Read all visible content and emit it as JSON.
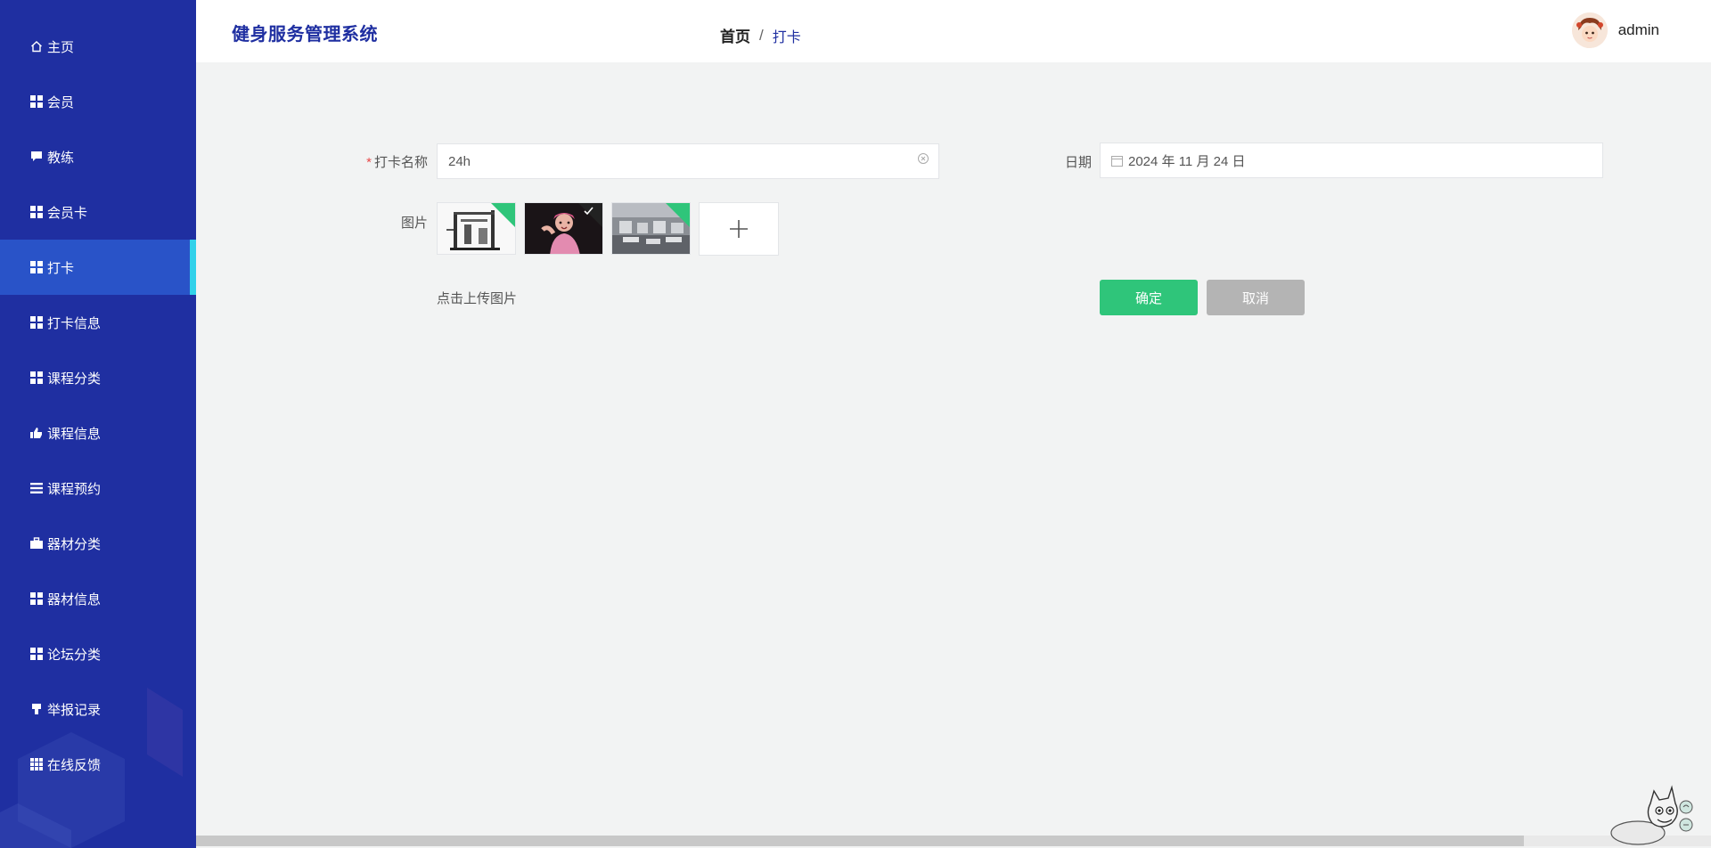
{
  "app": {
    "title": "健身服务管理系统"
  },
  "breadcrumb": {
    "home": "首页",
    "separator": "/",
    "current": "打卡"
  },
  "user": {
    "name": "admin"
  },
  "sidebar": {
    "active_index": 4,
    "items": [
      {
        "label": "主页",
        "icon": "home-icon"
      },
      {
        "label": "会员",
        "icon": "grid-icon"
      },
      {
        "label": "教练",
        "icon": "comment-icon"
      },
      {
        "label": "会员卡",
        "icon": "grid-icon"
      },
      {
        "label": "打卡",
        "icon": "grid-icon"
      },
      {
        "label": "打卡信息",
        "icon": "grid-icon"
      },
      {
        "label": "课程分类",
        "icon": "grid-icon"
      },
      {
        "label": "课程信息",
        "icon": "thumbs-up-icon"
      },
      {
        "label": "课程预约",
        "icon": "list-icon"
      },
      {
        "label": "器材分类",
        "icon": "briefcase-icon"
      },
      {
        "label": "器材信息",
        "icon": "grid-icon"
      },
      {
        "label": "论坛分类",
        "icon": "grid-icon"
      },
      {
        "label": "举报记录",
        "icon": "thumbs-down-icon"
      },
      {
        "label": "在线反馈",
        "icon": "table-icon"
      }
    ]
  },
  "form": {
    "name": {
      "label": "打卡名称",
      "required_mark": "*",
      "value": "24h"
    },
    "date": {
      "label": "日期",
      "value": "2024 年 11 月 24 日"
    },
    "images": {
      "label": "图片",
      "thumbnails": [
        "gym-machine-image",
        "athlete-image",
        "gym-hall-image"
      ],
      "hint": "点击上传图片"
    },
    "confirm_label": "确定",
    "cancel_label": "取消"
  },
  "colors": {
    "sidebar_bg": "#1f2fa1",
    "sidebar_active": "#2953c8",
    "active_indicator": "#31d1ea",
    "confirm": "#2fc57a",
    "cancel": "#b4b4b4",
    "page_bg": "#f2f3f3"
  }
}
